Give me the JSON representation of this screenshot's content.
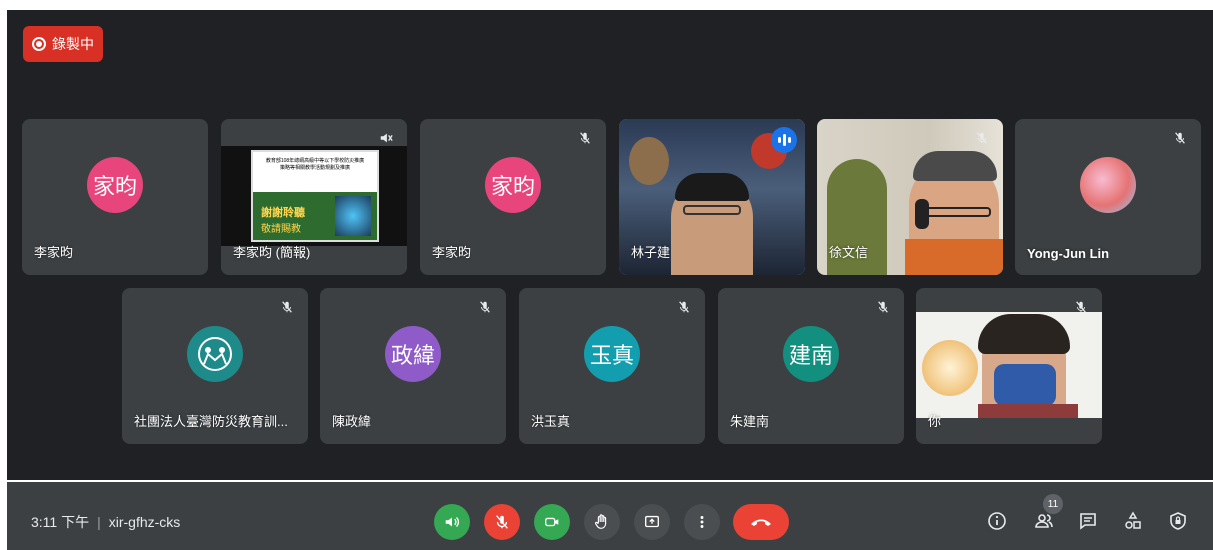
{
  "recording": {
    "label": "錄製中"
  },
  "tiles": [
    {
      "name": "李家昀",
      "avatar_text": "家昀",
      "avatar_color": "#e8457c"
    },
    {
      "name": "李家昀 (簡報)",
      "slide_line1": "教育部108年總綱高級中等以下學校防災推廣",
      "slide_line2": "策略等相關教學活動規劃及推廣",
      "slide_thanks": "謝謝聆聽",
      "slide_sub": "敬請賜教"
    },
    {
      "name": "李家昀",
      "avatar_text": "家昀",
      "avatar_color": "#e8457c"
    },
    {
      "name": "林子建"
    },
    {
      "name": "徐文信"
    },
    {
      "name": "Yong-Jun Lin"
    },
    {
      "name": "社團法人臺灣防災教育訓...",
      "avatar_color": "#1f8a8a"
    },
    {
      "name": "陳政緯",
      "avatar_text": "政緯",
      "avatar_color": "#8e5bc8"
    },
    {
      "name": "洪玉真",
      "avatar_text": "玉真",
      "avatar_color": "#129eaf"
    },
    {
      "name": "朱建南",
      "avatar_text": "建南",
      "avatar_color": "#128f7e"
    },
    {
      "name": "你"
    }
  ],
  "bottom": {
    "time": "3:11 下午",
    "meeting_code": "xir-gfhz-cks",
    "participants_count": "11"
  },
  "colors": {
    "green": "#34a853",
    "red": "#ea4335",
    "dark_button": "#3c4043"
  }
}
